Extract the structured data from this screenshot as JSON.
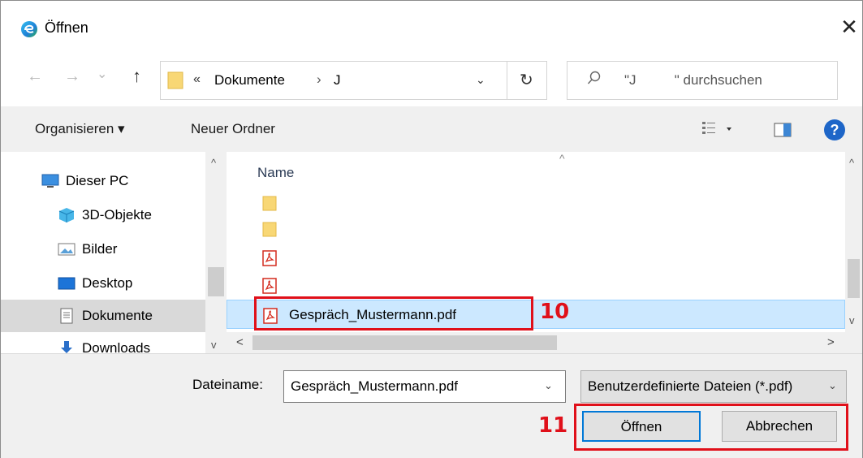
{
  "window": {
    "title": "Öffnen",
    "close_glyph": "✕",
    "app_icon": "edge-icon"
  },
  "nav": {
    "back_glyph": "←",
    "forward_glyph": "→",
    "recent_glyph": "⌄",
    "up_glyph": "↑",
    "address": {
      "prefix": "«",
      "folder": "Dokumente",
      "separator": "›",
      "current": "J",
      "dropdown_glyph": "⌄",
      "refresh_glyph": "↻"
    },
    "search": {
      "icon": "search-icon",
      "placeholder": "\"J          \" durchsuchen"
    }
  },
  "toolbar": {
    "organize_label": "Organisieren ▾",
    "new_folder_label": "Neuer Ordner",
    "help_label": "?"
  },
  "sidebar": {
    "items": [
      {
        "label": "Dieser PC",
        "icon": "monitor-icon"
      },
      {
        "label": "3D-Objekte",
        "icon": "cube-icon"
      },
      {
        "label": "Bilder",
        "icon": "pictures-icon"
      },
      {
        "label": "Desktop",
        "icon": "desktop-icon"
      },
      {
        "label": "Dokumente",
        "icon": "documents-icon",
        "selected": true
      },
      {
        "label": "Downloads",
        "icon": "download-icon"
      }
    ],
    "scroll_up_glyph": "^",
    "scroll_down_glyph": "v"
  },
  "files": {
    "column_name": "Name",
    "sort_glyph": "^",
    "rows": [
      {
        "label": "",
        "icon": "folder-icon"
      },
      {
        "label": "",
        "icon": "folder-icon"
      },
      {
        "label": "",
        "icon": "pdf-icon"
      },
      {
        "label": "",
        "icon": "pdf-icon"
      },
      {
        "label": "Gespräch_Mustermann.pdf",
        "icon": "pdf-icon",
        "selected": true
      }
    ],
    "scroll_left_glyph": "<",
    "scroll_right_glyph": ">",
    "vscroll_up_glyph": "^",
    "vscroll_down_glyph": "v"
  },
  "bottom": {
    "filename_label": "Dateiname:",
    "filename_value": "Gespräch_Mustermann.pdf",
    "dropdown_glyph": "⌄",
    "filetype_value": "Benutzerdefinierte Dateien (*.pdf)",
    "open_label": "Öffnen",
    "cancel_label": "Abbrechen"
  },
  "annotations": {
    "step_10": "10",
    "step_11": "11",
    "color": "#e0101a"
  },
  "colors": {
    "selection": "#cce8ff",
    "accent": "#0078d7",
    "folder": "#f8d775",
    "pdf_red": "#d42b1e"
  }
}
